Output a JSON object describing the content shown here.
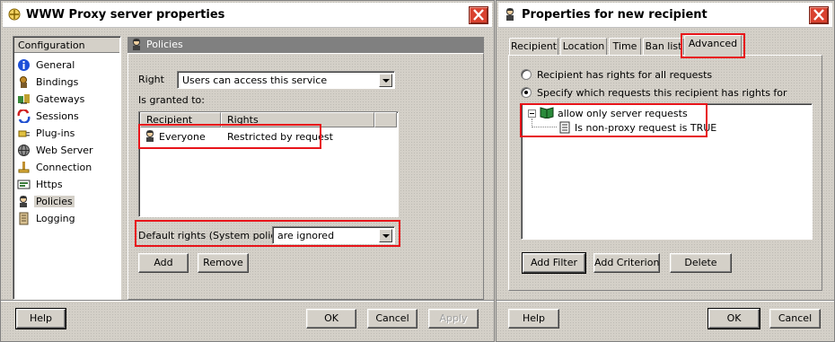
{
  "left_window": {
    "title": "WWW Proxy server properties",
    "nav_header": "Configuration",
    "nav_items": [
      {
        "label": "General",
        "icon": "info-icon"
      },
      {
        "label": "Bindings",
        "icon": "bindings-icon"
      },
      {
        "label": "Gateways",
        "icon": "gateways-icon"
      },
      {
        "label": "Sessions",
        "icon": "sessions-icon"
      },
      {
        "label": "Plug-ins",
        "icon": "plugin-icon"
      },
      {
        "label": "Web Server",
        "icon": "web-server-icon"
      },
      {
        "label": "Connection",
        "icon": "connection-icon"
      },
      {
        "label": "Https",
        "icon": "https-icon"
      },
      {
        "label": "Policies",
        "icon": "policies-icon"
      },
      {
        "label": "Logging",
        "icon": "logging-icon"
      }
    ],
    "selected_nav": "Policies",
    "panel_title": "Policies",
    "right_label": "Right",
    "right_value": "Users can access this service",
    "granted_label": "Is granted to:",
    "table": {
      "columns": [
        "Recipient",
        "Rights"
      ],
      "rows": [
        {
          "recipient": "Everyone",
          "rights": "Restricted by request"
        }
      ]
    },
    "default_rights_label": "Default rights (System policies)",
    "default_rights_value": "are ignored",
    "add_label": "Add",
    "remove_label": "Remove",
    "help_label": "Help",
    "ok_label": "OK",
    "cancel_label": "Cancel",
    "apply_label": "Apply"
  },
  "right_window": {
    "title": "Properties for new recipient",
    "tabs": [
      "Recipient",
      "Location",
      "Time",
      "Ban list",
      "Advanced"
    ],
    "active_tab": "Advanced",
    "radio_all": "Recipient has rights for all requests",
    "radio_specify": "Specify which requests this recipient has rights for",
    "tree": {
      "root": "allow only server requests",
      "child": "Is non-proxy request is TRUE"
    },
    "add_filter_label": "Add Filter",
    "add_criterion_label": "Add Criterion",
    "delete_label": "Delete",
    "help_label": "Help",
    "ok_label": "OK",
    "cancel_label": "Cancel"
  },
  "colors": {
    "highlight_box": "#e8141a",
    "close_button": "#d9412f",
    "dialog_face": "#d4d0c8"
  }
}
